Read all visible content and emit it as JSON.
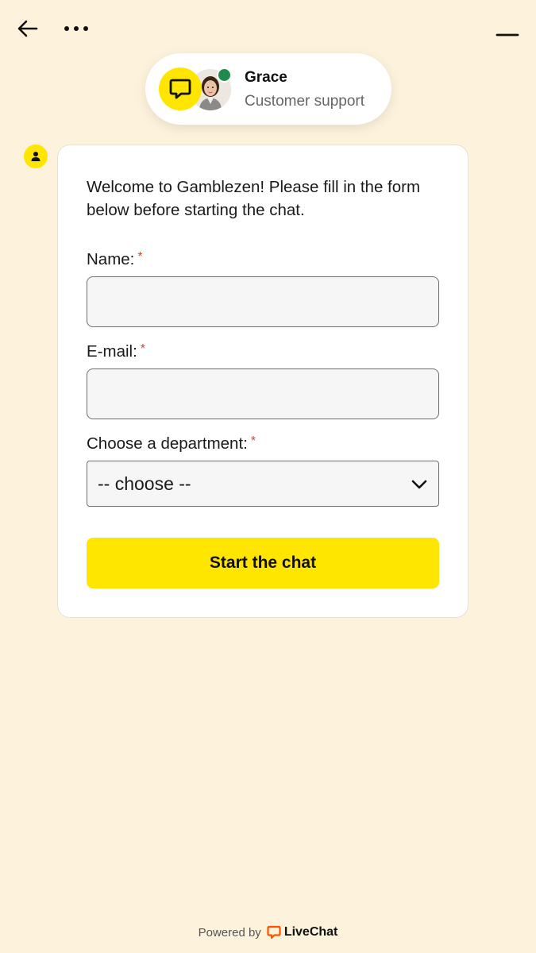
{
  "header": {
    "back_icon": "arrow-left-icon",
    "more_icon": "more-horizontal-icon",
    "minimize_icon": "minimize-icon"
  },
  "agent": {
    "name": "Grace",
    "role": "Customer support",
    "status": "online",
    "brand_icon": "chat-bubble-icon"
  },
  "form": {
    "welcome_text": "Welcome to Gamblezen! Please fill in the form below before starting the chat.",
    "required_marker": "*",
    "name_label": "Name:",
    "name_value": "",
    "email_label": "E-mail:",
    "email_value": "",
    "department_label": "Choose a department:",
    "department_selected": "-- choose --",
    "submit_label": "Start the chat"
  },
  "footer": {
    "powered_by": "Powered by",
    "brand": "LiveChat"
  },
  "colors": {
    "background": "#fdf3dd",
    "accent": "#ffe600",
    "online": "#1f8a4c",
    "required": "#d3462f",
    "livechat_brand": "#ff5100"
  }
}
